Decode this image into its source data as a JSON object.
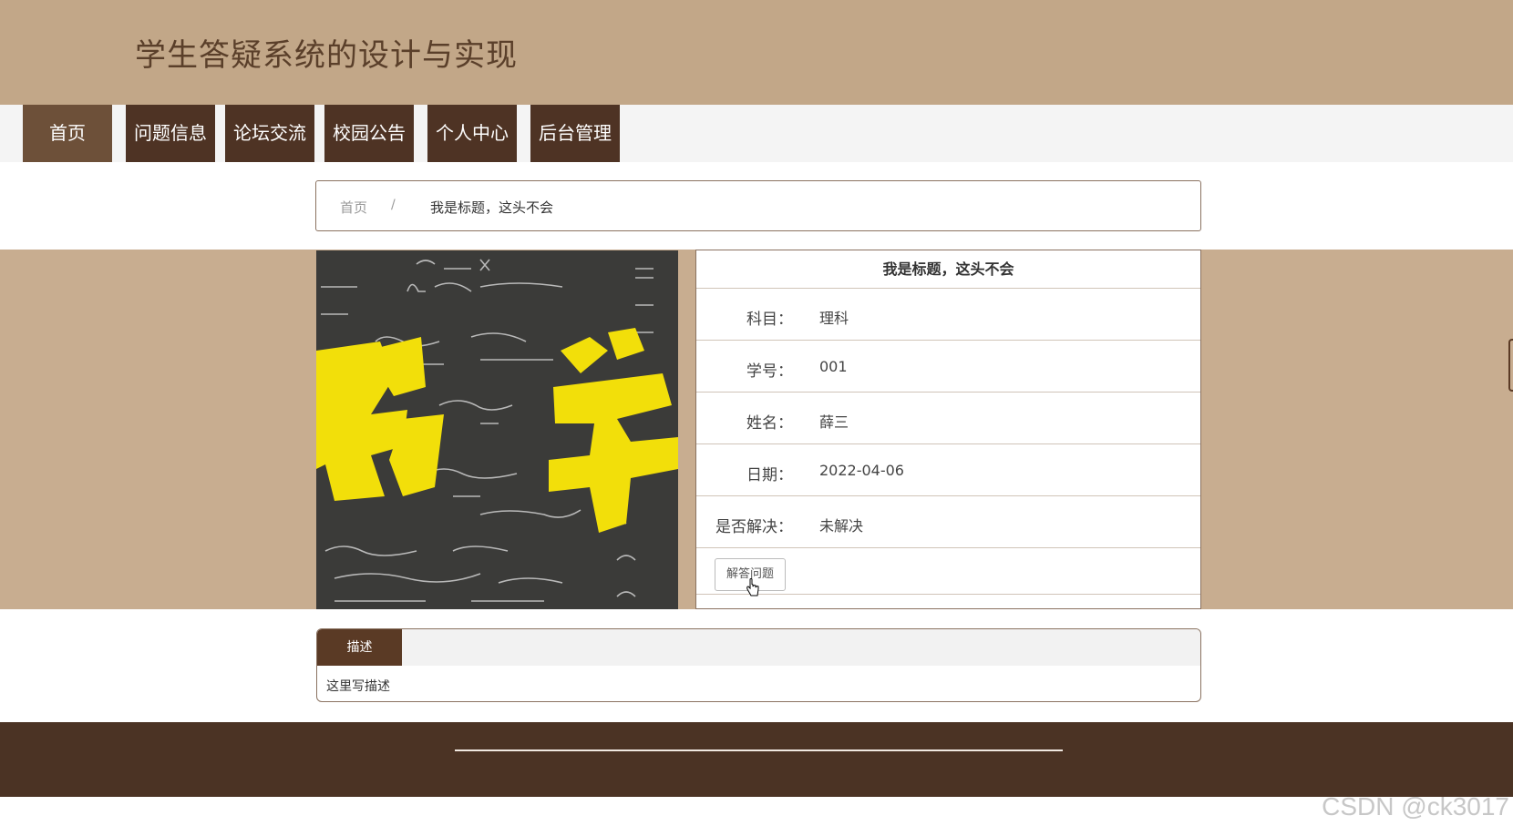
{
  "header": {
    "title": "学生答疑系统的设计与实现"
  },
  "nav": {
    "items": [
      {
        "label": "首页"
      },
      {
        "label": "问题信息"
      },
      {
        "label": "论坛交流"
      },
      {
        "label": "校园公告"
      },
      {
        "label": "个人中心"
      },
      {
        "label": "后台管理"
      }
    ],
    "active_index": 0
  },
  "breadcrumb": {
    "home": "首页",
    "separator": "/",
    "current": "我是标题，这头不会"
  },
  "detail": {
    "title": "我是标题，这头不会",
    "fields": [
      {
        "label": "科目：",
        "value": "理科"
      },
      {
        "label": "学号：",
        "value": "001"
      },
      {
        "label": "姓名：",
        "value": "薛三"
      },
      {
        "label": "日期：",
        "value": "2022-04-06"
      },
      {
        "label": "是否解决：",
        "value": "未解决"
      }
    ],
    "answer_button": "解答问题"
  },
  "description": {
    "tab": "描述",
    "text": "这里写描述"
  },
  "watermark": "CSDN @ck3017",
  "colors": {
    "header": "#c2a788",
    "nav_active": "#6d5039",
    "nav_item": "#4e3324",
    "footer": "#4b3324",
    "band": "#c8ad90"
  }
}
